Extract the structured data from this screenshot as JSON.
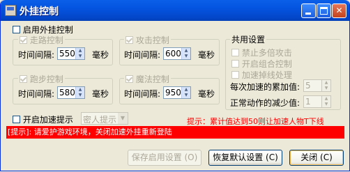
{
  "window": {
    "title": "外挂控制"
  },
  "master": {
    "label": "启用外挂控制"
  },
  "walk": {
    "label": "走路控制",
    "interval_label": "时间间隔:",
    "value": "550",
    "unit": "毫秒"
  },
  "attack": {
    "label": "攻击控制",
    "interval_label": "时间间隔:",
    "value": "600",
    "unit": "毫秒"
  },
  "run": {
    "label": "跑步控制",
    "interval_label": "时间间隔:",
    "value": "580",
    "unit": "毫秒"
  },
  "magic": {
    "label": "魔法控制",
    "interval_label": "时间间隔:",
    "value": "950",
    "unit": "毫秒"
  },
  "shared": {
    "title": "共用设置",
    "opt1": "禁止多倍攻击",
    "opt2": "开启组合控制",
    "opt3": "加速掉线处理",
    "accum_label": "每次加速的累加值:",
    "accum_value": "5",
    "reduce_label": "正常动作的减少值:",
    "reduce_value": "1"
  },
  "accel": {
    "label": "开启加速提示",
    "combo_value": "密人提示"
  },
  "notice": "提示：累计值达到50则让加速人物T下线",
  "hint": "[提示]: 请爱护游戏环境，关闭加速外挂重新登陆",
  "buttons": {
    "save": "保存启用设置 (O)",
    "restore": "恢复默认设置 (C)",
    "close": "关闭 (C)"
  },
  "colors": {
    "title_bar": "#0454E0",
    "notice_text": "#FF0000",
    "hint_bg": "#FF0000",
    "window_bg": "#ECE9D8"
  }
}
